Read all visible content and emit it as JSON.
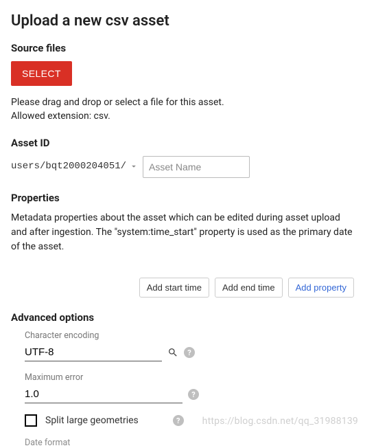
{
  "title": "Upload a new csv asset",
  "source": {
    "heading": "Source files",
    "selectLabel": "SELECT",
    "hint1": "Please drag and drop or select a file for this asset.",
    "hint2": "Allowed extension: csv."
  },
  "assetId": {
    "heading": "Asset ID",
    "path": "users/bqt2000204051/",
    "placeholder": "Asset Name"
  },
  "properties": {
    "heading": "Properties",
    "desc": "Metadata properties about the asset which can be edited during asset upload and after ingestion. The \"system:time_start\" property is used as the primary date of the asset.",
    "addStart": "Add start time",
    "addEnd": "Add end time",
    "addProp": "Add property"
  },
  "advanced": {
    "heading": "Advanced options",
    "encodingLabel": "Character encoding",
    "encodingValue": "UTF-8",
    "maxErrorLabel": "Maximum error",
    "maxErrorValue": "1.0",
    "splitLabel": "Split large geometries",
    "dateFormatLabel": "Date format"
  },
  "watermark": "https://blog.csdn.net/qq_31988139"
}
